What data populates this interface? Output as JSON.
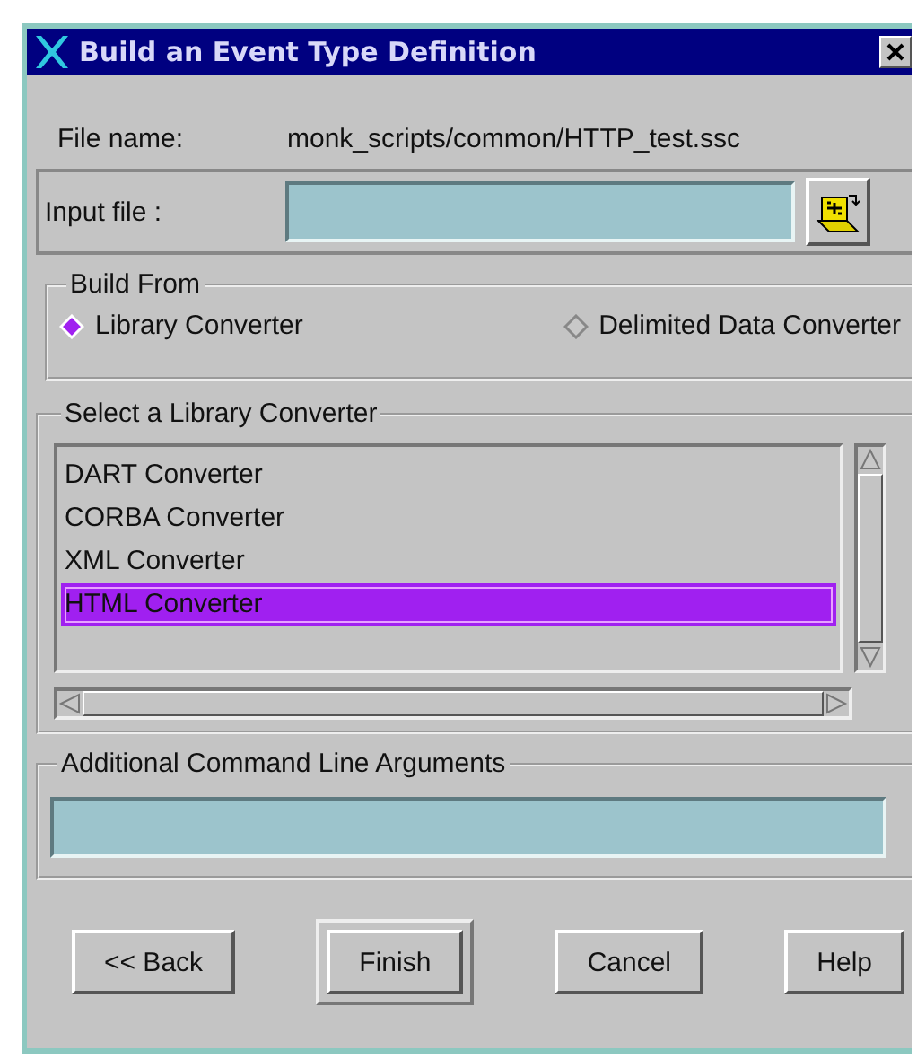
{
  "window": {
    "title": "Build an Event Type Definition"
  },
  "file_name": {
    "label": "File name:",
    "value": "monk_scripts/common/HTTP_test.ssc"
  },
  "input_file": {
    "label": "Input file :"
  },
  "build_from": {
    "title": "Build From",
    "options": [
      {
        "label": "Library Converter",
        "selected": true
      },
      {
        "label": "Delimited Data Converter",
        "selected": false
      }
    ]
  },
  "library": {
    "title": "Select a Library Converter",
    "items": [
      {
        "label": "DART Converter",
        "selected": false
      },
      {
        "label": "CORBA Converter",
        "selected": false
      },
      {
        "label": "XML Converter",
        "selected": false
      },
      {
        "label": "HTML Converter",
        "selected": true
      }
    ]
  },
  "arguments": {
    "title": "Additional Command Line Arguments"
  },
  "buttons": [
    {
      "label": "<< Back",
      "default": false
    },
    {
      "label": "Finish",
      "default": true
    },
    {
      "label": "Cancel",
      "default": false
    },
    {
      "label": "Help",
      "default": false
    }
  ]
}
